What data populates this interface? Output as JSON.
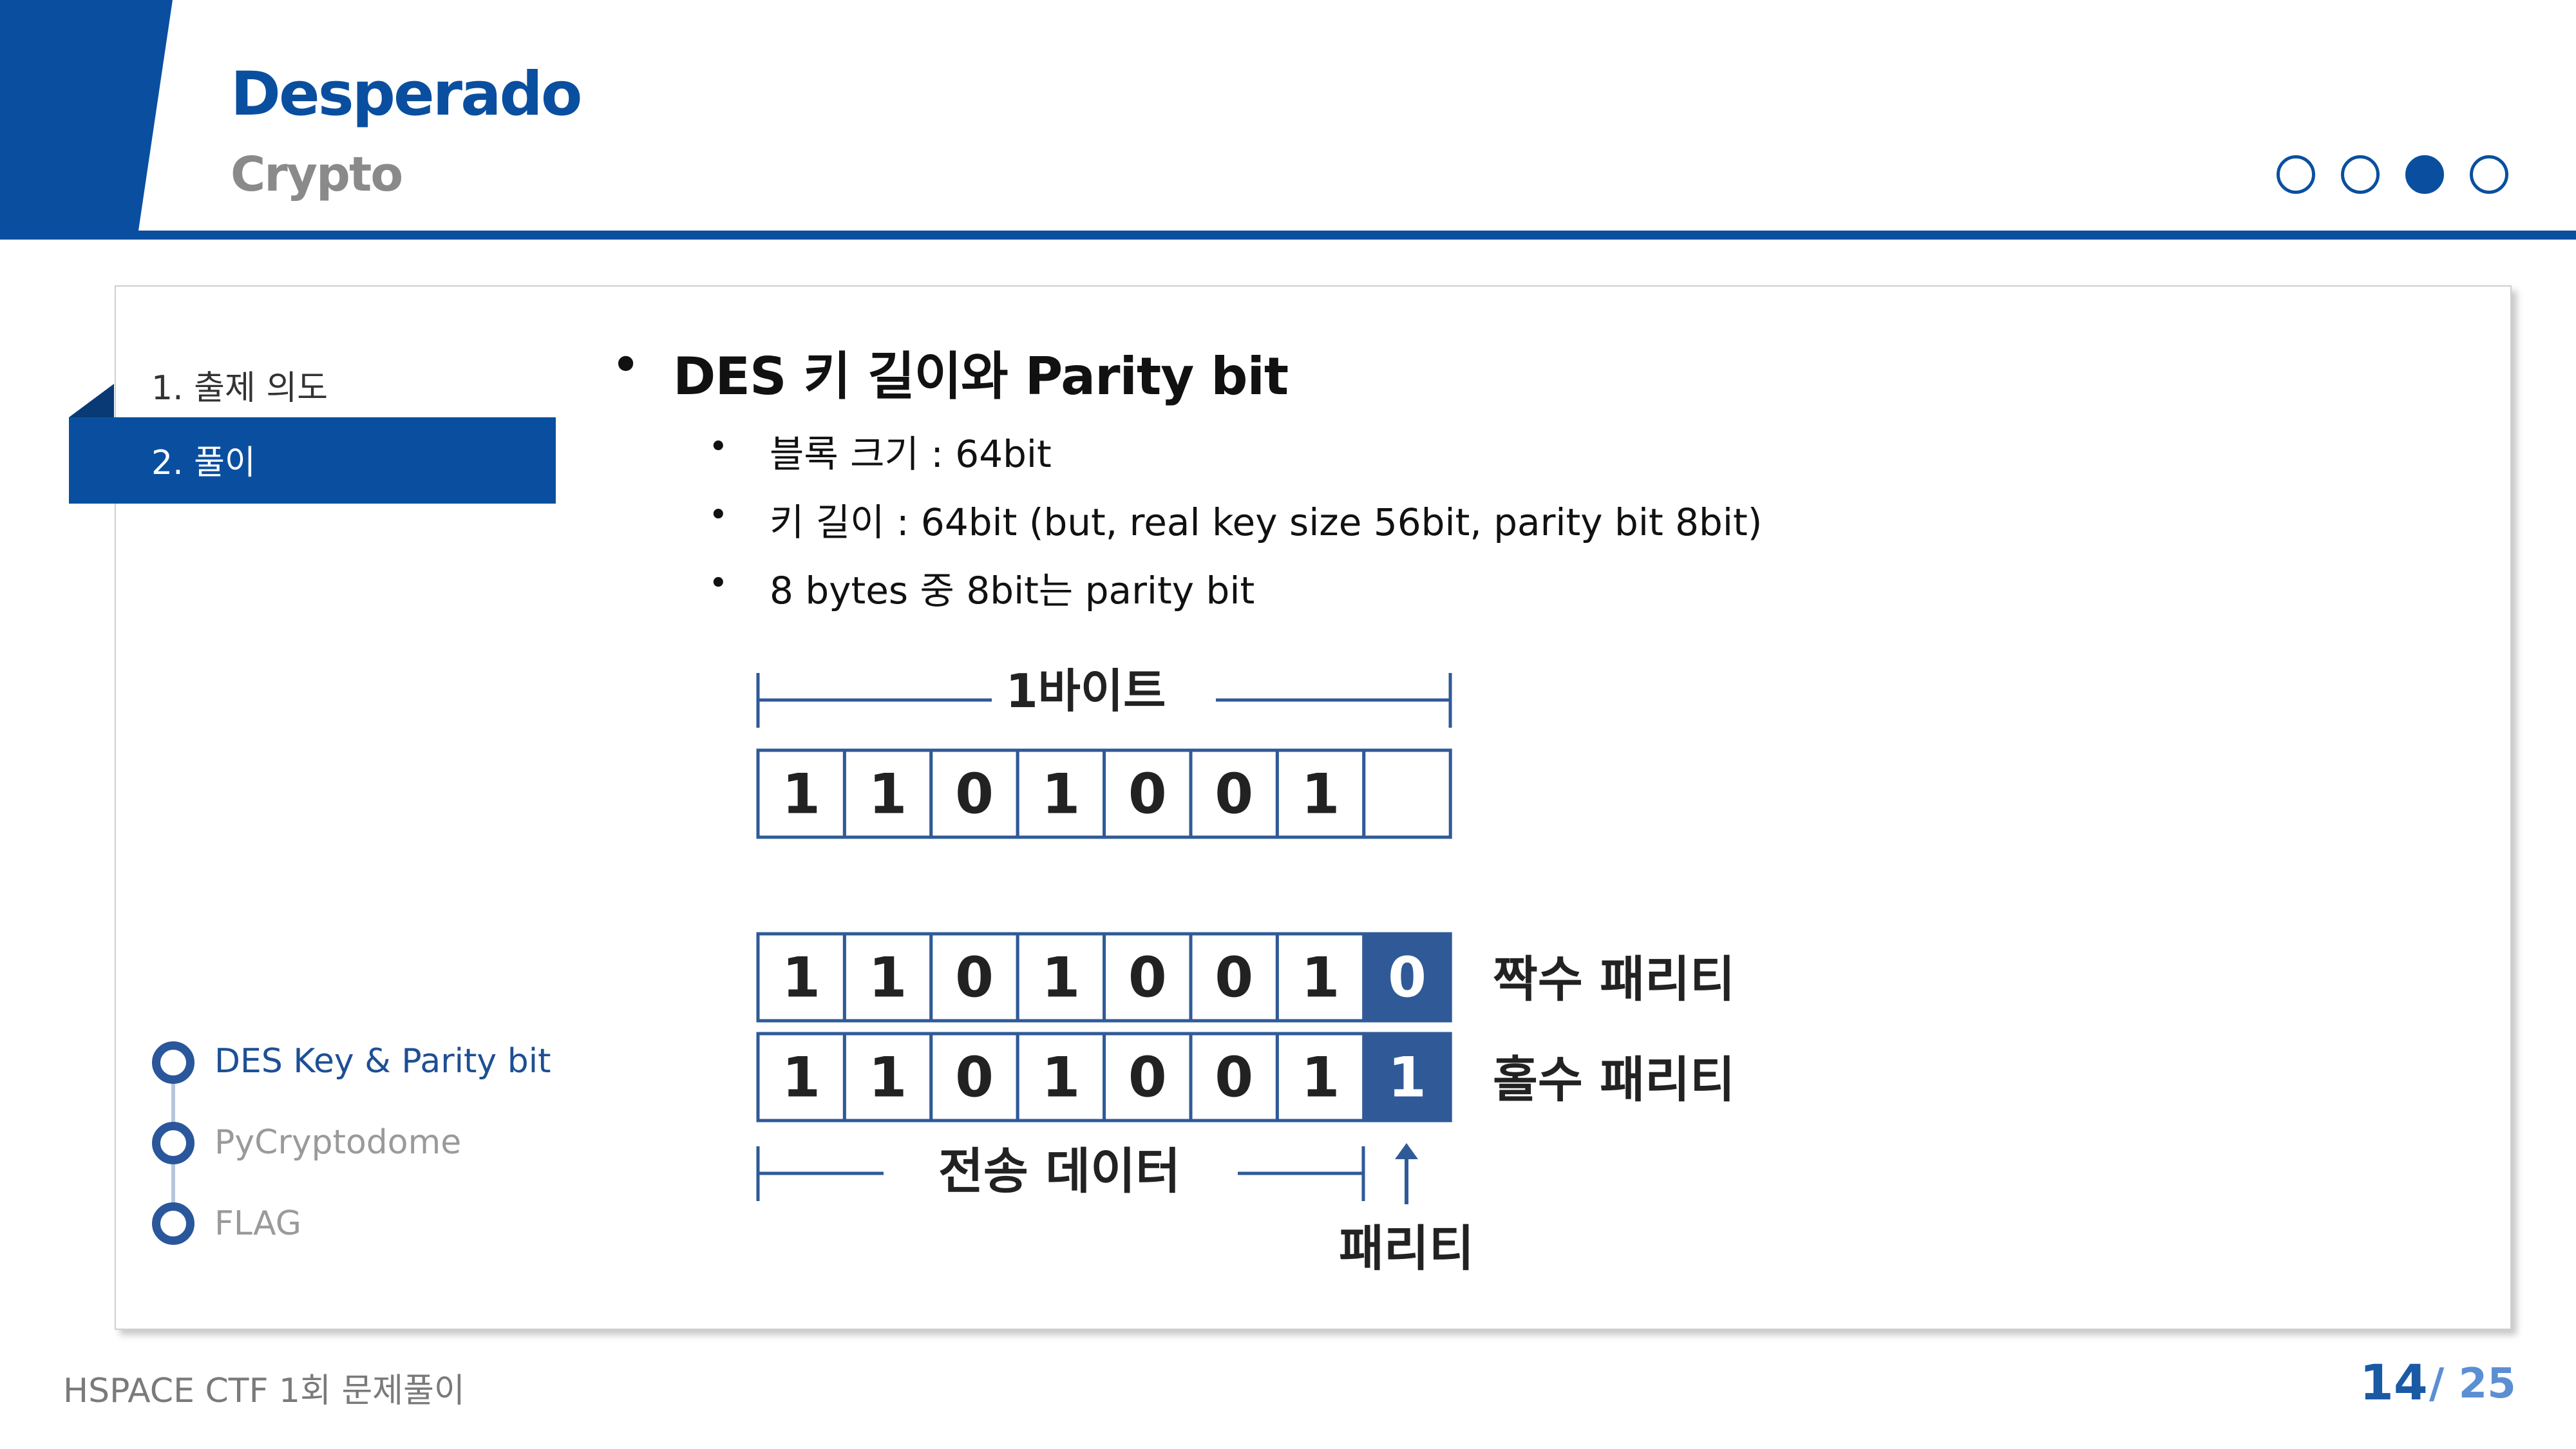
{
  "header": {
    "title": "Desperado",
    "subtitle": "Crypto"
  },
  "progress_dots": {
    "count": 4,
    "active_index": 2
  },
  "nav": {
    "items": [
      {
        "label": "1. 출제 의도",
        "active": false
      },
      {
        "label": "2. 풀이",
        "active": true
      }
    ]
  },
  "content": {
    "heading": "DES 키 길이와 Parity bit",
    "bullets": [
      "블록 크기 : 64bit",
      "키 길이 : 64bit (but, real key size 56bit, parity bit 8bit)",
      "8 bytes 중 8bit는 parity bit"
    ]
  },
  "diagram": {
    "byte_label": "1바이트",
    "top_row": [
      "1",
      "1",
      "0",
      "1",
      "0",
      "0",
      "1",
      ""
    ],
    "even_row": [
      "1",
      "1",
      "0",
      "1",
      "0",
      "0",
      "1",
      "0"
    ],
    "odd_row": [
      "1",
      "1",
      "0",
      "1",
      "0",
      "0",
      "1",
      "1"
    ],
    "even_label": "짝수 패리티",
    "odd_label": "홀수 패리티",
    "data_label": "전송 데이터",
    "parity_label": "패리티",
    "accent_color": "#2f5a97"
  },
  "toc": {
    "items": [
      {
        "label": "DES Key & Parity bit",
        "active": true
      },
      {
        "label": "PyCryptodome",
        "active": false
      },
      {
        "label": "FLAG",
        "active": false
      }
    ]
  },
  "footer": {
    "left": "HSPACE CTF 1회 문제풀이",
    "page_current": "14",
    "page_total": "/ 25"
  },
  "colors": {
    "brand": "#0a4f9f",
    "muted": "#9a9a9a"
  }
}
